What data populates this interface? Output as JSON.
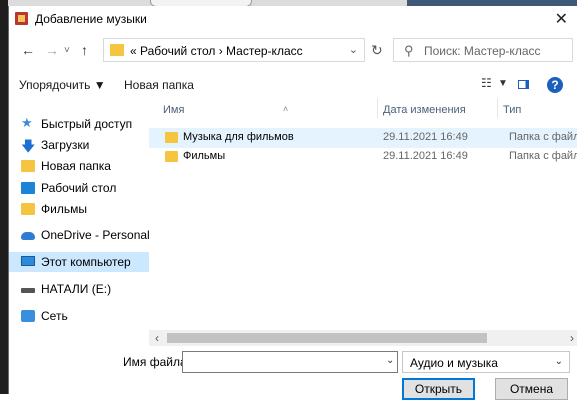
{
  "window": {
    "title": "Добавление музыки"
  },
  "nav": {
    "address_parts": [
      "«",
      "Рабочий стол",
      "›",
      "Мастер-класс"
    ],
    "search_placeholder": "Поиск: Мастер-класс"
  },
  "toolbar": {
    "organize_label": "Упорядочить ▼",
    "new_folder_label": "Новая папка"
  },
  "sidebar": {
    "items": [
      {
        "label": "Быстрый доступ",
        "icon": "star-icon"
      },
      {
        "label": "Загрузки",
        "icon": "download-icon"
      },
      {
        "label": "Новая папка",
        "icon": "folder-icon"
      },
      {
        "label": "Рабочий стол",
        "icon": "desktop-icon"
      },
      {
        "label": "Фильмы",
        "icon": "folder-icon"
      },
      {
        "label": "OneDrive - Personal",
        "icon": "cloud-icon"
      },
      {
        "label": "Этот компьютер",
        "icon": "computer-icon"
      },
      {
        "label": "НАТАЛИ (E:)",
        "icon": "drive-icon"
      },
      {
        "label": "Сеть",
        "icon": "network-icon"
      }
    ]
  },
  "files": {
    "columns": {
      "name": "Имя",
      "date": "Дата изменения",
      "type": "Тип"
    },
    "rows": [
      {
        "name": "Музыка для фильмов",
        "date": "29.11.2021 16:49",
        "type": "Папка с файлами"
      },
      {
        "name": "Фильмы",
        "date": "29.11.2021 16:49",
        "type": "Папка с файлами"
      }
    ]
  },
  "bottom": {
    "filename_label": "Имя файла:",
    "filename_value": "",
    "filter_value": "Аудио и музыка",
    "open_label": "Открыть",
    "cancel_label": "Отмена"
  },
  "colors": {
    "accent": "#0078d7",
    "selected_bg": "#cce8ff",
    "folder": "#f5c542"
  }
}
